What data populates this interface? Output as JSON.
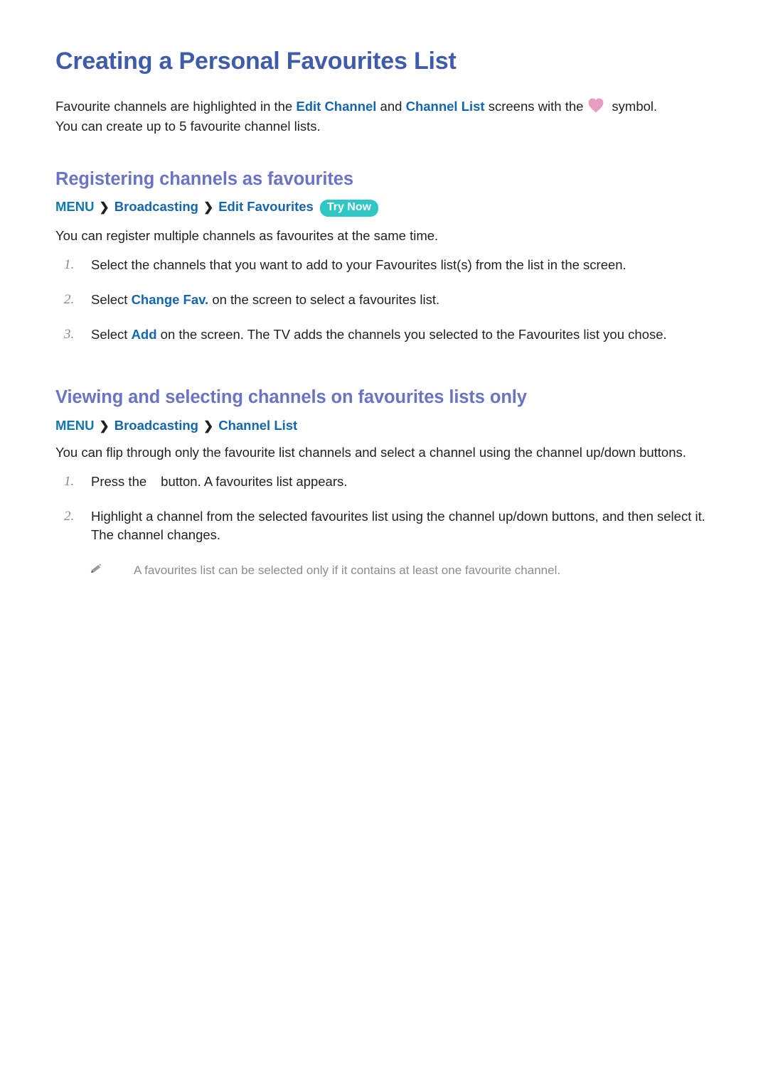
{
  "document": {
    "title": "Creating a Personal Favourites List",
    "intro": {
      "line1_part1": "Favourite channels are highlighted in the ",
      "link1": "Edit Channel",
      "line1_part2": " and ",
      "link2": "Channel List",
      "line1_part3": " screens with the",
      "heart_icon": "heart-icon",
      "line1_part4": "symbol.",
      "line2": "You can create up to 5 favourite channel lists."
    },
    "sections": [
      {
        "heading": "Registering channels as favourites",
        "breadcrumb": {
          "menu": "MENU",
          "separator": "❯",
          "item1": "Broadcasting",
          "item2": "Edit Favourites",
          "badge": "Try Now"
        },
        "paragraph": "You can register multiple channels as favourites at the same time.",
        "steps": [
          {
            "number": "1.",
            "text_part1": "Select the channels that you want to add to your Favourites list(s) from the list in the screen."
          },
          {
            "number": "2.",
            "text_part1": "Select ",
            "link": "Change Fav.",
            "text_part2": " on the screen to select a favourites list."
          },
          {
            "number": "3.",
            "text_part1": "Select ",
            "link": "Add",
            "text_part2": " on the screen. The TV adds the channels you selected to the Favourites list you chose."
          }
        ]
      },
      {
        "heading": "Viewing and selecting channels on favourites lists only",
        "breadcrumb": {
          "menu": "MENU",
          "separator": "❯",
          "item1": "Broadcasting",
          "item2": "Channel List"
        },
        "paragraph": "You can flip through only the favourite list channels and select a channel using the channel up/down buttons.",
        "steps": [
          {
            "number": "1.",
            "text_part1": "Press the",
            "text_part2": "button. A favourites list appears."
          },
          {
            "number": "2.",
            "text_part1": "Highlight a channel from the selected favourites list using the channel up/down buttons, and then select it. The channel changes."
          }
        ],
        "note": {
          "icon": "pencil-icon",
          "text": "A favourites list can be selected only if it contains at least one favourite channel."
        }
      }
    ],
    "colors": {
      "title": "#3e5ca9",
      "section_heading": "#6b73c4",
      "link_blue": "#1566b0",
      "menu_teal": "#1178a8",
      "badge_teal": "#2ec7c4",
      "heart_pink": "#e79cc2",
      "body_text": "#231f20",
      "note_gray": "#8c8c8c",
      "step_number_gray": "#8a8a8a"
    }
  }
}
